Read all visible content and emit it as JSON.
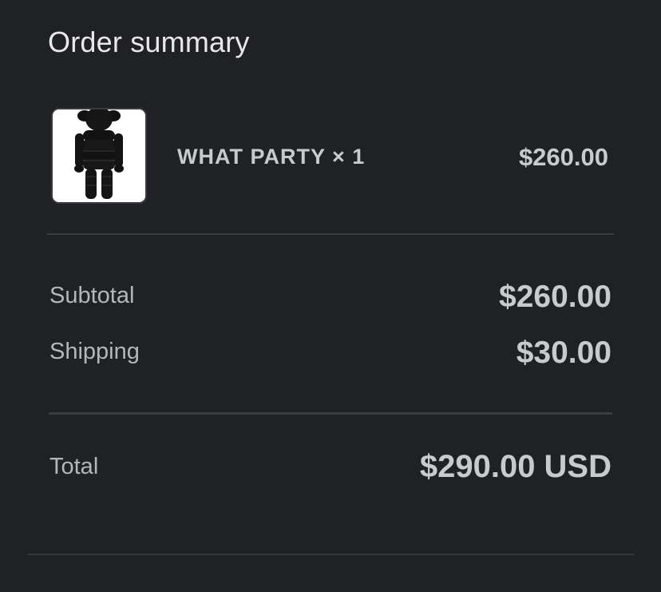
{
  "summary": {
    "title": "Order summary"
  },
  "item": {
    "name": "WHAT PARTY × 1",
    "price": "$260.00",
    "image_icon": "figure-thumbnail-icon"
  },
  "totals": {
    "subtotal_label": "Subtotal",
    "subtotal_value": "$260.00",
    "shipping_label": "Shipping",
    "shipping_value": "$30.00",
    "total_label": "Total",
    "total_value": "$290.00 USD"
  },
  "colors": {
    "background": "#202125",
    "text_primary": "#c9cacd",
    "divider": "#3b3c41"
  }
}
